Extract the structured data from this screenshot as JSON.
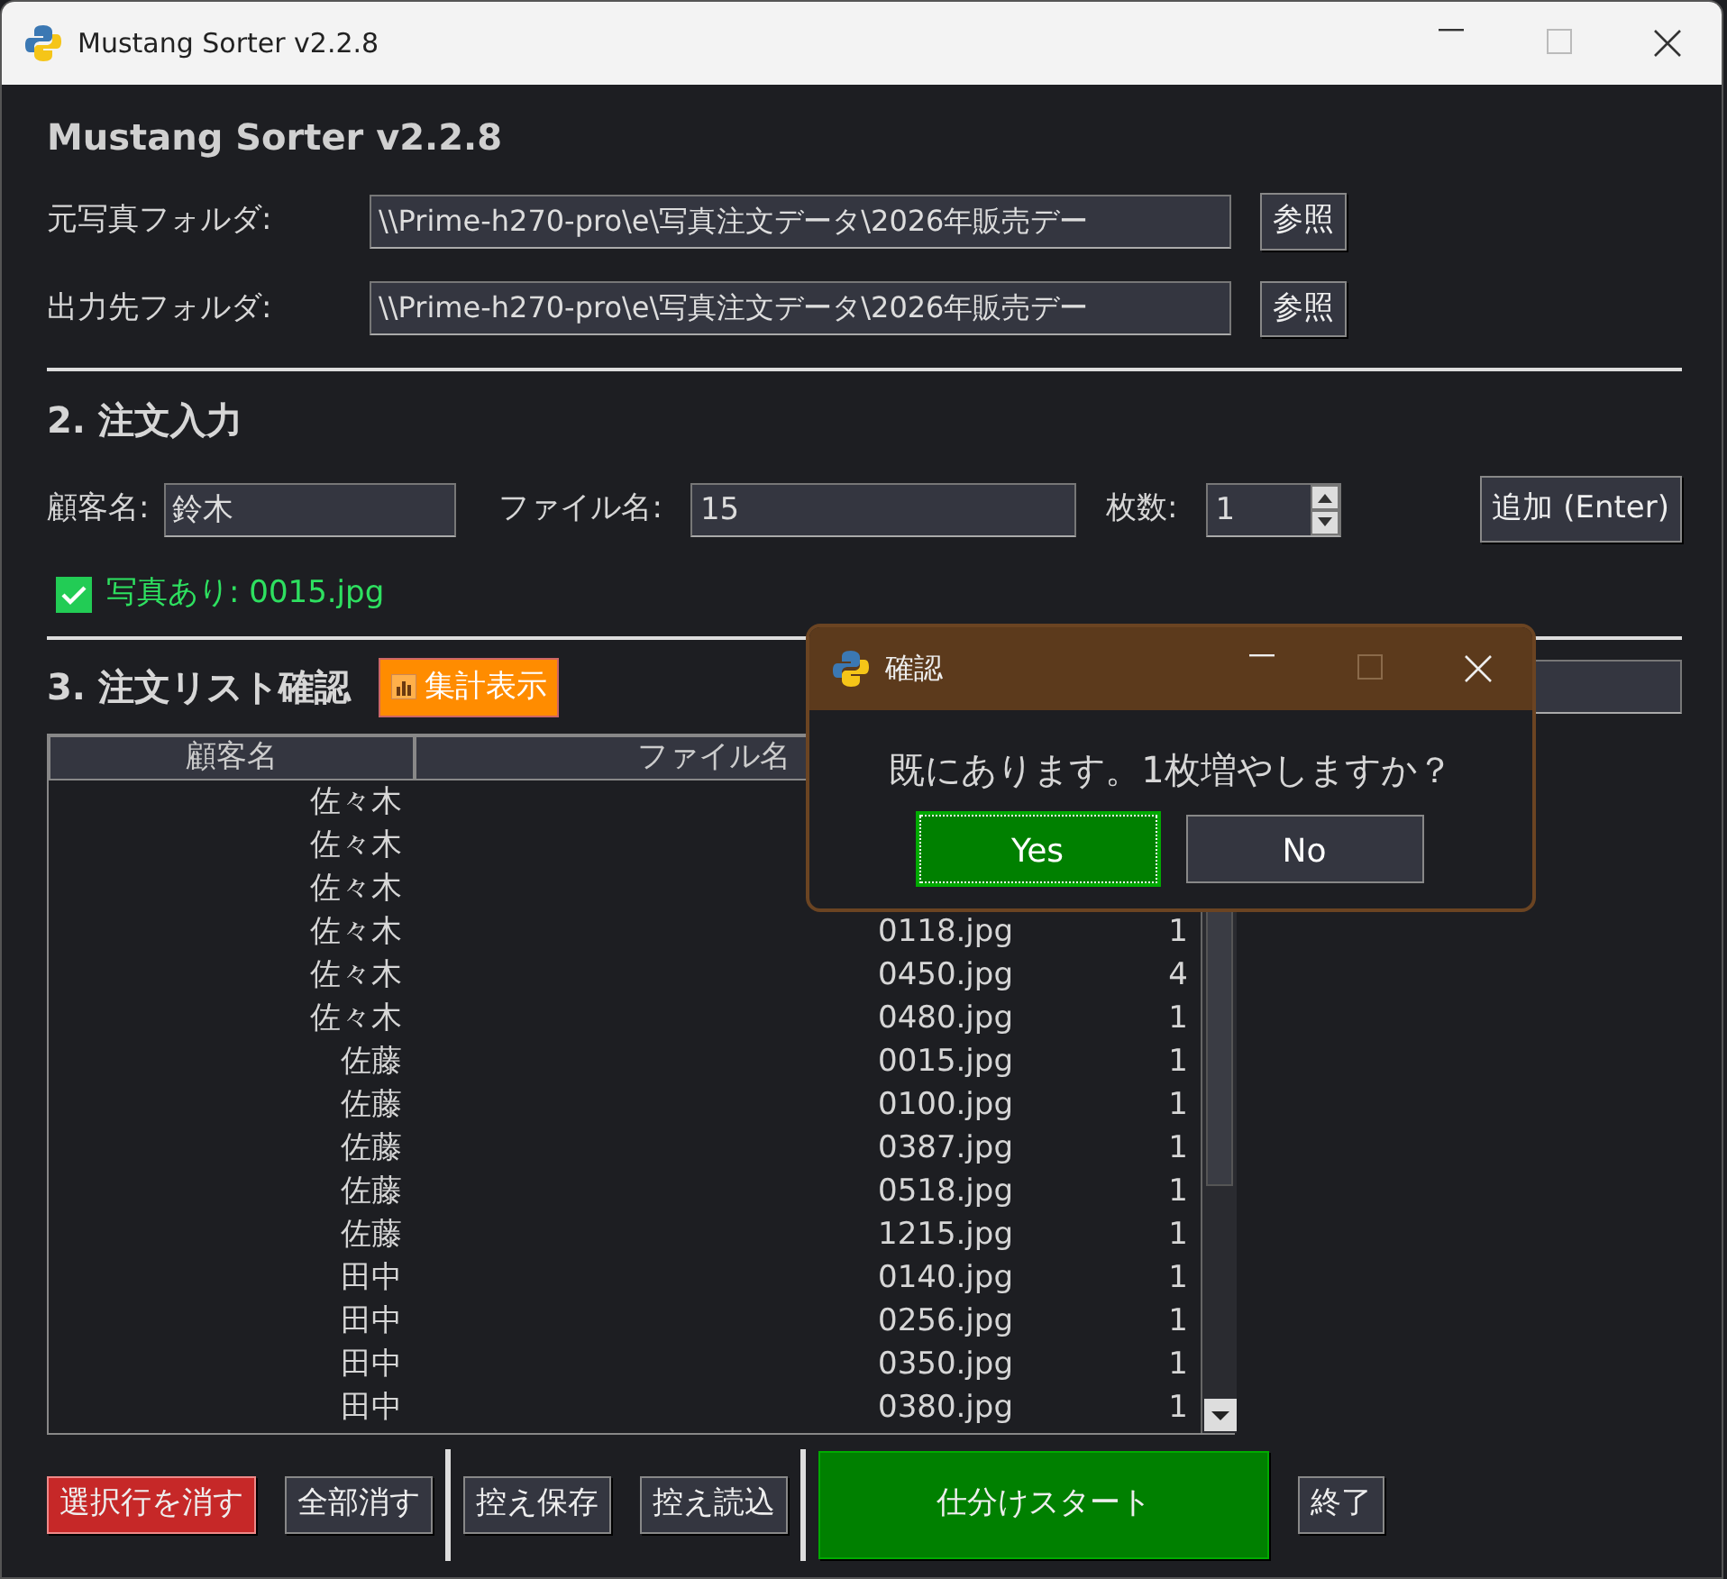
{
  "window": {
    "title": "Mustang Sorter v2.2.8"
  },
  "app_title": "Mustang Sorter v2.2.8",
  "folders": [
    {
      "label": "元写真フォルダ:",
      "value": "\\\\Prime-h270-pro\\e\\写真注文データ\\2026年販売デー",
      "button": "参照"
    },
    {
      "label": "出力先フォルダ:",
      "value": "\\\\Prime-h270-pro\\e\\写真注文データ\\2026年販売デー",
      "button": "参照"
    }
  ],
  "order_input": {
    "title": "2. 注文入力",
    "customer_label": "顧客名:",
    "customer_value": "鈴木",
    "file_label": "ファイル名:",
    "file_value": "15",
    "count_label": "枚数:",
    "count_value": "1",
    "add_button": "追加 (Enter)",
    "photo_status": {
      "checked": true,
      "text": "写真あり: 0015.jpg"
    }
  },
  "order_list": {
    "title": "3. 注文リスト確認",
    "summary_button": "集計表示",
    "columns": [
      "顧客名",
      "ファイル名"
    ],
    "rows": [
      {
        "customer": "佐々木"
      },
      {
        "customer": "佐々木"
      },
      {
        "customer": "佐々木"
      },
      {
        "customer": "佐々木",
        "file": "0118.jpg",
        "count": "1"
      },
      {
        "customer": "佐々木",
        "file": "0450.jpg",
        "count": "4"
      },
      {
        "customer": "佐々木",
        "file": "0480.jpg",
        "count": "1"
      },
      {
        "customer": "佐藤",
        "file": "0015.jpg",
        "count": "1"
      },
      {
        "customer": "佐藤",
        "file": "0100.jpg",
        "count": "1"
      },
      {
        "customer": "佐藤",
        "file": "0387.jpg",
        "count": "1"
      },
      {
        "customer": "佐藤",
        "file": "0518.jpg",
        "count": "1"
      },
      {
        "customer": "佐藤",
        "file": "1215.jpg",
        "count": "1"
      },
      {
        "customer": "田中",
        "file": "0140.jpg",
        "count": "1"
      },
      {
        "customer": "田中",
        "file": "0256.jpg",
        "count": "1"
      },
      {
        "customer": "田中",
        "file": "0350.jpg",
        "count": "1"
      },
      {
        "customer": "田中",
        "file": "0380.jpg",
        "count": "1"
      }
    ]
  },
  "actions": [
    {
      "kind": "danger",
      "label": "選択行を消す"
    },
    {
      "kind": "normal",
      "label": "全部消す"
    },
    {
      "kind": "separator"
    },
    {
      "kind": "normal",
      "label": "控え保存"
    },
    {
      "kind": "normal",
      "label": "控え読込"
    },
    {
      "kind": "separator"
    },
    {
      "kind": "primary",
      "label": "仕分けスタート"
    },
    {
      "kind": "normal",
      "label": "終了"
    }
  ],
  "dialog": {
    "title": "確認",
    "message": "既にあります。1枚増やしますか？",
    "buttons": [
      {
        "label": "Yes",
        "selected": true
      },
      {
        "label": "No",
        "selected": false
      }
    ]
  }
}
